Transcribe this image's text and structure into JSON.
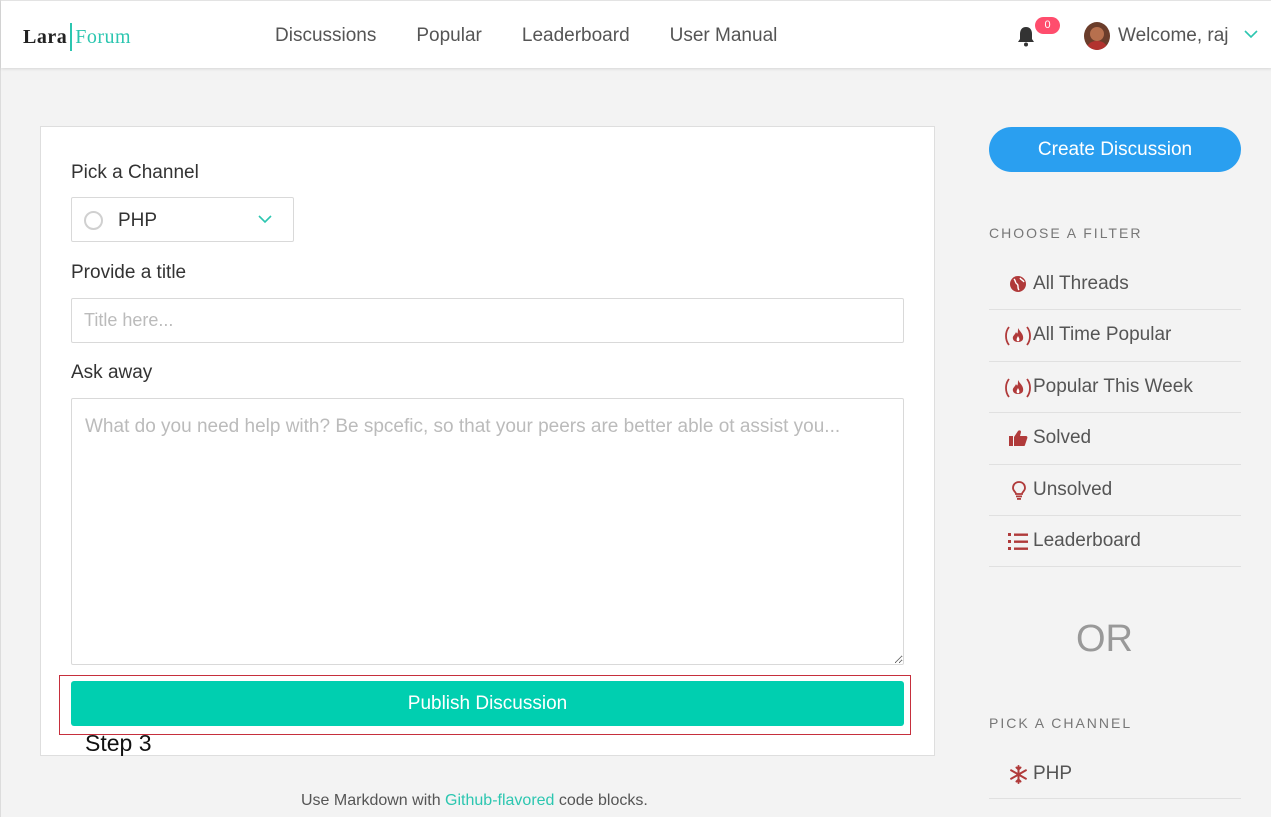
{
  "brand": {
    "part1": "Lara",
    "part2": "Forum"
  },
  "nav": {
    "links": [
      "Discussions",
      "Popular",
      "Leaderboard",
      "User Manual"
    ],
    "notification_count": "0",
    "welcome": "Welcome, raj"
  },
  "form": {
    "channel_label": "Pick a Channel",
    "channel_value": "PHP",
    "title_label": "Provide a title",
    "title_placeholder": "Title here...",
    "body_label": "Ask away",
    "body_placeholder": "What do you need help with? Be spcefic, so that your peers are better able ot assist you...",
    "publish_label": "Publish Discussion",
    "step_annotation": "Step 3",
    "hint_prefix": "Use Markdown with ",
    "hint_link": "Github-flavored",
    "hint_suffix": " code blocks."
  },
  "sidebar": {
    "create_label": "Create Discussion",
    "filter_title": "CHOOSE A FILTER",
    "filters": [
      "All Threads",
      "All Time Popular",
      "Popular This Week",
      "Solved",
      "Unsolved",
      "Leaderboard"
    ],
    "or_text": "OR",
    "channel_title": "PICK A CHANNEL",
    "channels": [
      "PHP"
    ]
  },
  "colors": {
    "accent_teal": "#00cfb0",
    "primary_blue": "#2a9ff0",
    "icon_red": "#b03a3a",
    "highlight_red": "#c62f3d"
  }
}
